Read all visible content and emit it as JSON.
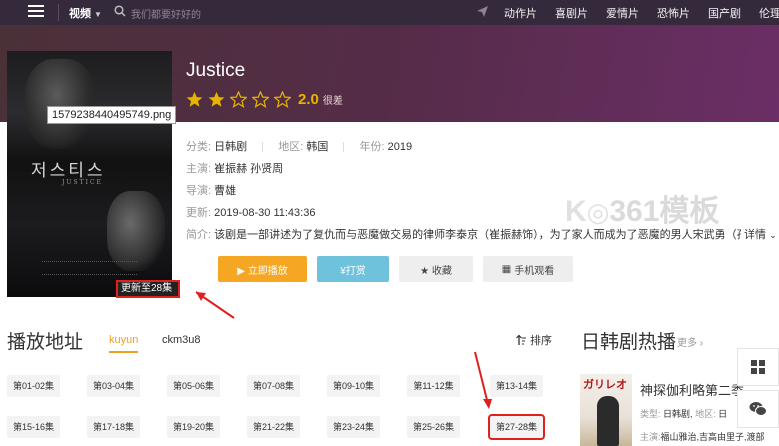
{
  "nav": {
    "category": "视频",
    "search_placeholder": "我们都要好好的",
    "links": [
      "动作片",
      "喜剧片",
      "爱情片",
      "恐怖片",
      "国产剧",
      "伦理片"
    ]
  },
  "movie": {
    "title": "Justice",
    "rating": "2.0",
    "rating_label": "很差",
    "stars_filled": 2,
    "stars_total": 5,
    "poster_korean": "저스티스",
    "poster_sub": "JUSTICE",
    "image_tooltip": "1579238440495749.png",
    "update_badge": "更新至28集",
    "category_label": "分类:",
    "category": "日韩剧",
    "region_label": "地区:",
    "region": "韩国",
    "year_label": "年份:",
    "year": "2019",
    "cast_label": "主演:",
    "cast": "崔振赫 孙贤周",
    "director_label": "导演:",
    "director": "曹雄",
    "updated_label": "更新:",
    "updated": "2019-08-30 11:43:36",
    "desc_label": "简介:",
    "desc": "该剧是一部讲述为了复仇而与恶魔做交易的律师李泰京（崔振赫饰），为了家人而成为了恶魔的男人宋武勇（孙贤",
    "detail_link": "详情"
  },
  "actions": {
    "play": "▶ 立即播放",
    "tip": "¥打赏",
    "fav": "★ 收藏",
    "mobile": "手机观看"
  },
  "playlist": {
    "title": "播放地址",
    "tabs": [
      "kuyun",
      "ckm3u8"
    ],
    "sort": "排序",
    "episodes": [
      "第01-02集",
      "第03-04集",
      "第05-06集",
      "第07-08集",
      "第09-10集",
      "第11-12集",
      "第13-14集",
      "第15-16集",
      "第17-18集",
      "第19-20集",
      "第21-22集",
      "第23-24集",
      "第25-26集",
      "第27-28集"
    ]
  },
  "sidebar": {
    "title": "日韩剧热播",
    "more": "更多",
    "item": {
      "name": "神探伽利略第二季",
      "poster_text": "ガリレオ",
      "type_label": "类型:",
      "type": "日韩剧,",
      "region_label": "地区:",
      "region": "日",
      "cast_label": "主演:",
      "cast": "福山雅治,吉高由里子,渡部"
    }
  },
  "watermark": "361模板",
  "colors": {
    "nav_bg": "#352a3c",
    "accent_orange": "#f5a623",
    "accent_blue": "#6ec2dc",
    "annotation_red": "#e0201f",
    "star_yellow": "#e8b400"
  }
}
